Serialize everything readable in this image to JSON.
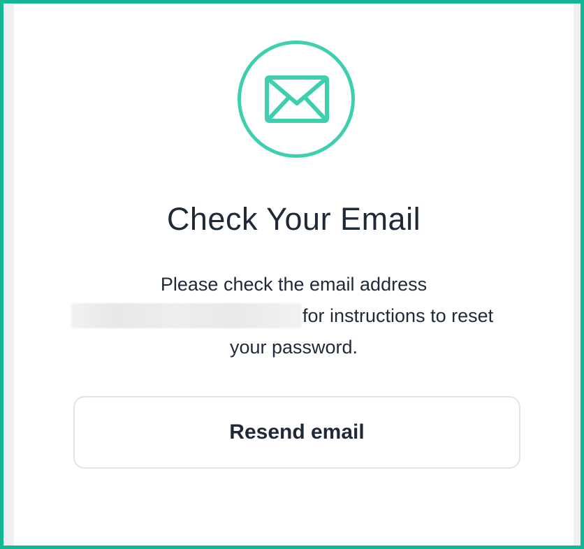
{
  "page": {
    "title": "Check Your Email",
    "message_line1": "Please check the email address",
    "message_line2_suffix": "for instructions to reset",
    "message_line3": "your password.",
    "resend_label": "Resend email"
  },
  "icons": {
    "envelope": "envelope-icon"
  },
  "colors": {
    "accent": "#3dcfae",
    "frame_border": "#12b894",
    "text": "#1f2937",
    "button_border": "#e3e4e8"
  }
}
